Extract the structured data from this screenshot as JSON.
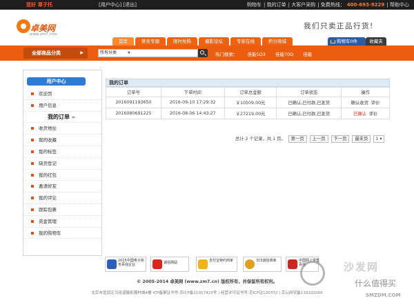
{
  "topbar": {
    "greeting": "您好",
    "username": "章子托",
    "member_center": "[用户中心]",
    "logout": "[退出]",
    "links": [
      "购物车",
      "我的订单",
      "大客户采购"
    ],
    "phone_label": "免费热线：",
    "phone": "400-693-9229",
    "help": "帮助中心"
  },
  "header": {
    "logo_cn": "卓美网",
    "logo_url": "www.zm7.com",
    "slogan": "我们只卖正品行货!",
    "tabs": [
      "首页",
      "禁卖专题",
      "限时抢购",
      "摄影论坛",
      "专家在线",
      "积分商城"
    ],
    "cart_label": "购物车0件",
    "fav_label": "收藏夹"
  },
  "searchbar": {
    "all_categories": "全部商品分类",
    "category_select": "所有分类",
    "hot_label": "热门搜索：",
    "hot_terms": [
      "佳能5D3",
      "佳能70D",
      "佳能"
    ]
  },
  "sidebar": {
    "title": "用户中心",
    "items": [
      {
        "label": "欢迎页"
      },
      {
        "label": "用户信息"
      },
      {
        "label": "我的订单",
        "selected": true
      },
      {
        "label": "收货地址"
      },
      {
        "label": "我的收藏"
      },
      {
        "label": "我的标签"
      },
      {
        "label": "缺货登记"
      },
      {
        "label": "我的红包"
      },
      {
        "label": "邀请好友"
      },
      {
        "label": "我的评论"
      },
      {
        "label": "跟踪包裹"
      },
      {
        "label": "资金管理"
      },
      {
        "label": "我的购物车"
      }
    ]
  },
  "orders": {
    "title": "我的订单",
    "columns": [
      "订单号",
      "下单时间",
      "订单总金额",
      "订单状态",
      "操作"
    ],
    "rows": [
      {
        "id": "2016091193650",
        "time": "2016-09-10 17:29:32",
        "amount": "￥10509.00元",
        "status": "已确认,已付款,已发货",
        "ops": [
          "确认收货",
          "评价"
        ]
      },
      {
        "id": "2016080691225",
        "time": "2016-08-06 14:43:27",
        "amount": "￥27219.00元",
        "status": "已确认,已付款,已发货",
        "ops": [
          "已确认",
          "评价"
        ]
      }
    ],
    "pager": {
      "summary": "总计 2 个记录，共 1 页。",
      "first": "第一页",
      "prev": "上一页",
      "next": "下一页",
      "last": "最末页",
      "page": "1"
    }
  },
  "footer": {
    "badges": [
      "2015中国电子商务百强企业",
      "诚信网站",
      "支付宝特约商家",
      "315诚信商家",
      "中国网上零售百强"
    ],
    "copyright": "© 2005-2014 卓美网 (www.zm7.cn) 版权所有，并保留所有权利。",
    "icp": "北京市宣武区马连道摄影器材城4楼 ICP备案证书号:京ICP备11017423号 | 经营许可证书号:京ICP证130372 | 京公网安备110102000"
  },
  "watermark": {
    "brand": "沙发网",
    "sub": "什么值得买",
    "url": "SMZDM.COM"
  },
  "colors": {
    "accent_orange": "#ec5d0f",
    "accent_blue": "#2d7bd3",
    "topbar_bg": "#1e1e1e"
  }
}
